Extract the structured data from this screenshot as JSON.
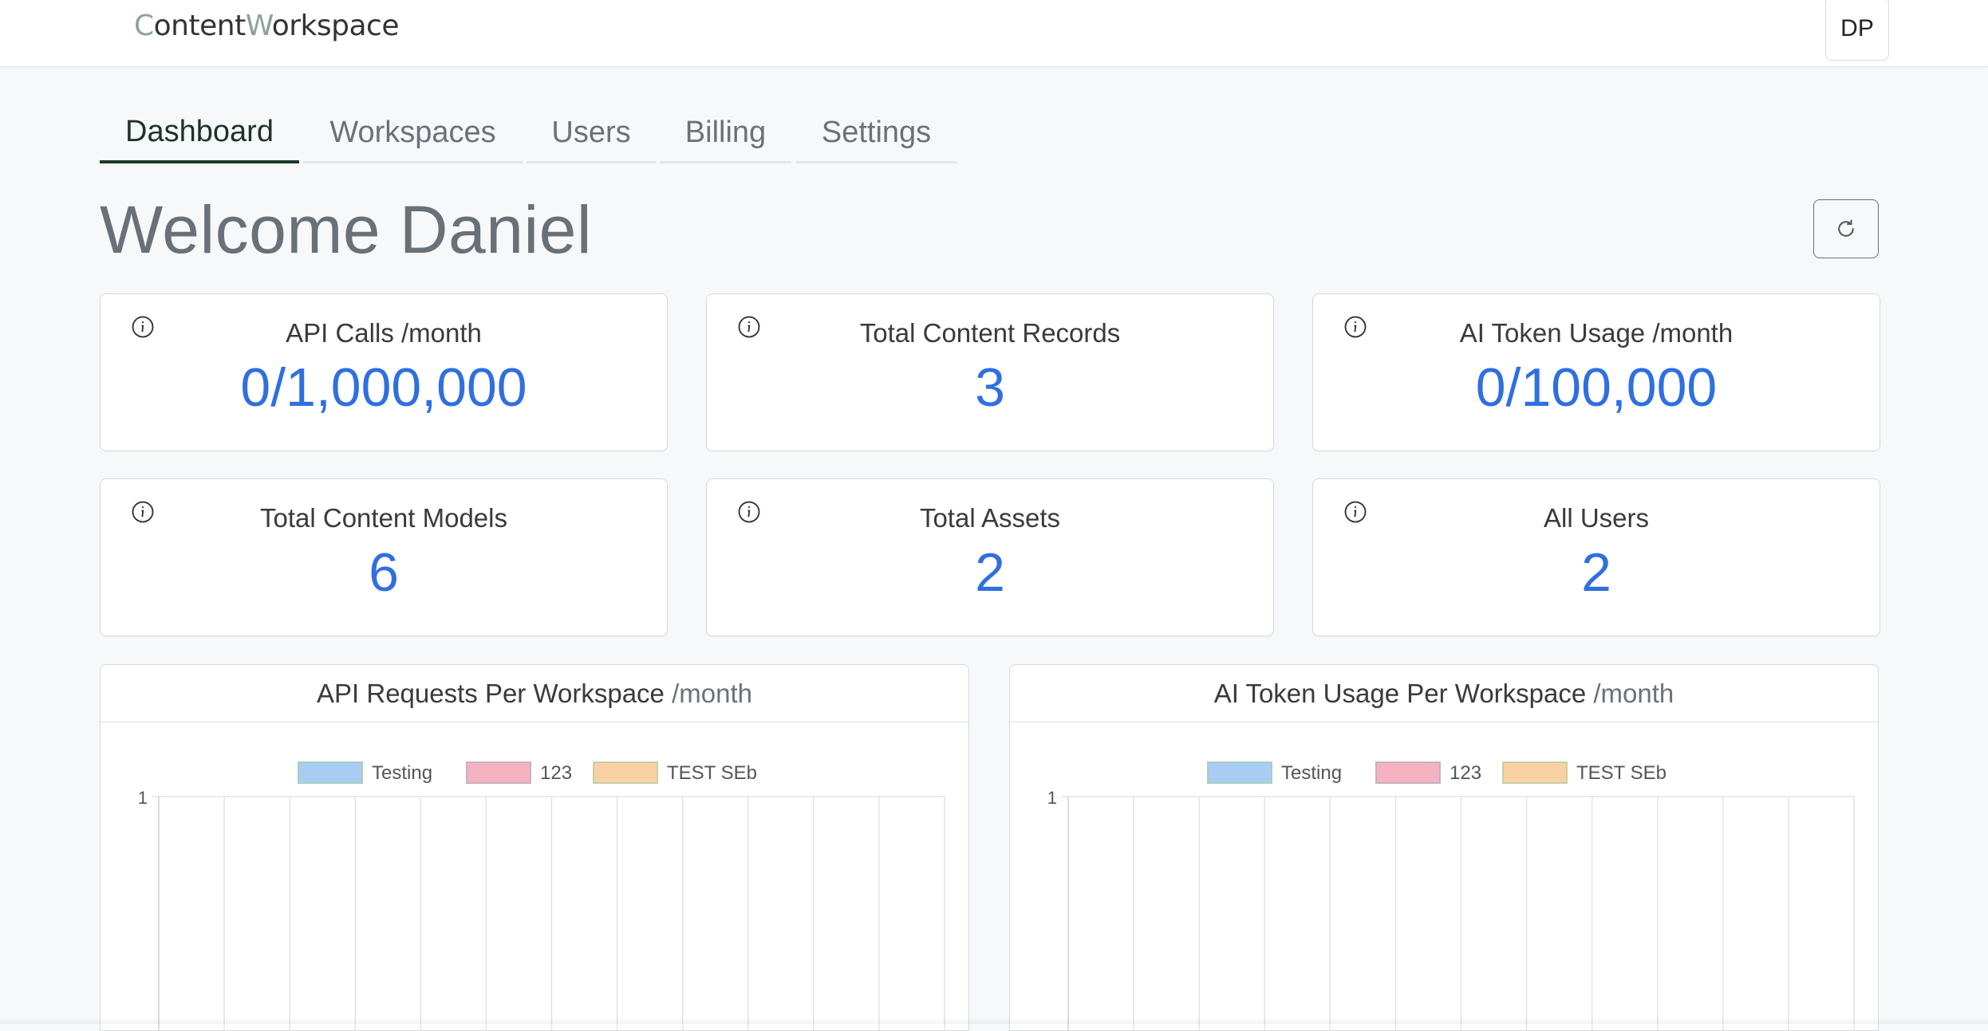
{
  "header": {
    "logo_first_letter": "C",
    "logo_mid": "ontent",
    "logo_w": "W",
    "logo_rest": "orkspace",
    "avatar_initials": "DP"
  },
  "tabs": [
    {
      "label": "Dashboard",
      "active": true
    },
    {
      "label": "Workspaces",
      "active": false
    },
    {
      "label": "Users",
      "active": false
    },
    {
      "label": "Billing",
      "active": false
    },
    {
      "label": "Settings",
      "active": false
    }
  ],
  "welcome": "Welcome Daniel",
  "refresh_icon": "refresh-icon",
  "stats": [
    {
      "title": "API Calls /month",
      "value": "0/1,000,000",
      "icon": "info-icon"
    },
    {
      "title": "Total Content Records",
      "value": "3",
      "icon": "info-icon"
    },
    {
      "title": "AI Token Usage /month",
      "value": "0/100,000",
      "icon": "info-icon"
    },
    {
      "title": "Total Content Models",
      "value": "6",
      "icon": "info-icon"
    },
    {
      "title": "Total Assets",
      "value": "2",
      "icon": "info-icon"
    },
    {
      "title": "All Users",
      "value": "2",
      "icon": "info-icon"
    }
  ],
  "panels": [
    {
      "title": "API Requests Per Workspace",
      "unit": "/month"
    },
    {
      "title": "AI Token Usage Per Workspace",
      "unit": "/month"
    }
  ],
  "colors": {
    "accent_value": "#2f6fe0",
    "tab_active": "#1c3a28",
    "logo_accent": "#8fa29a"
  },
  "chart_data": [
    {
      "type": "bar",
      "title": "API Requests Per Workspace /month",
      "series": [
        {
          "name": "Testing",
          "color": "#a9cdf2",
          "values": []
        },
        {
          "name": "123",
          "color": "#f5b3c1",
          "values": []
        },
        {
          "name": "TEST SEb",
          "color": "#f8d0a4",
          "values": []
        }
      ],
      "y_ticks_visible": [
        "1"
      ],
      "legend": "top-center",
      "grid": true
    },
    {
      "type": "bar",
      "title": "AI Token Usage Per Workspace /month",
      "series": [
        {
          "name": "Testing",
          "color": "#a9cdf2",
          "values": []
        },
        {
          "name": "123",
          "color": "#f5b3c1",
          "values": []
        },
        {
          "name": "TEST SEb",
          "color": "#f8d0a4",
          "values": []
        }
      ],
      "y_ticks_visible": [
        "1"
      ],
      "legend": "top-center",
      "grid": true
    }
  ]
}
